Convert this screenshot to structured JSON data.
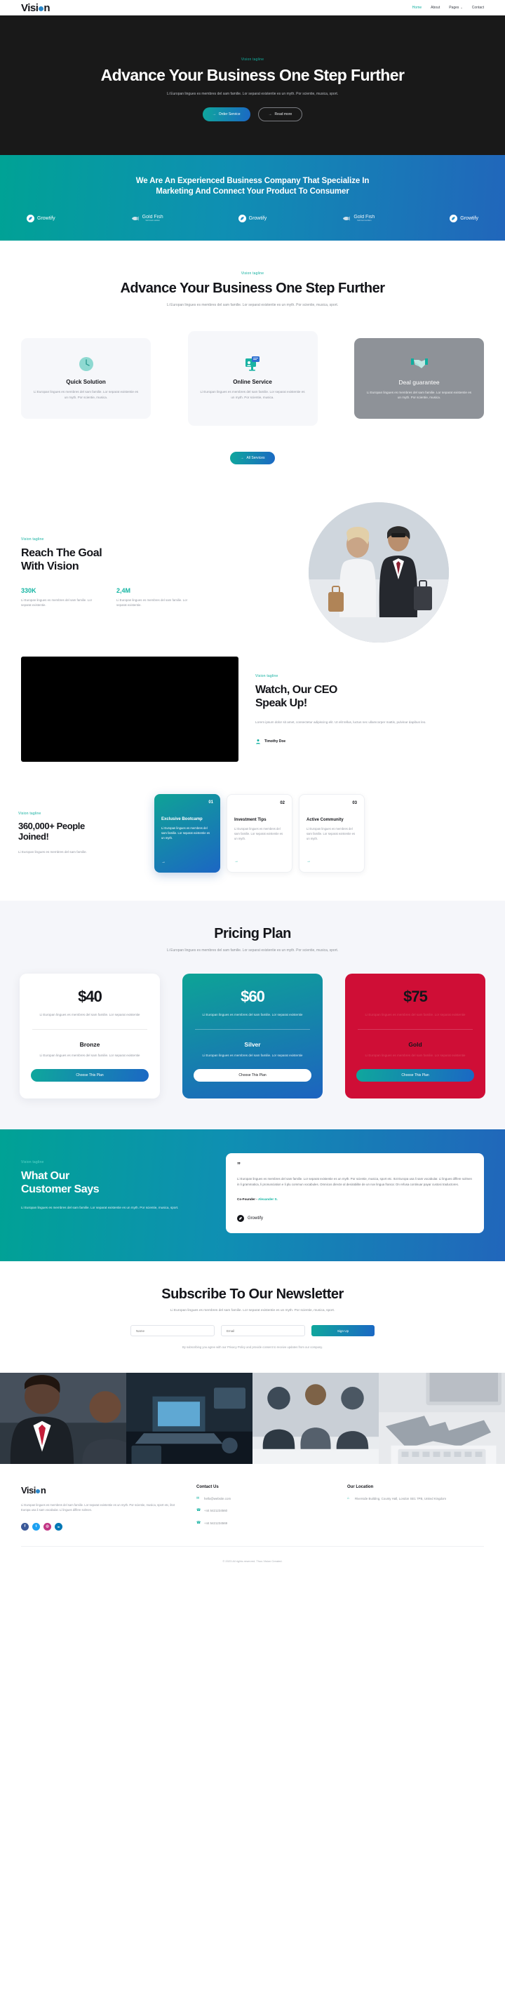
{
  "brand": {
    "name_part1": "Visi",
    "name_part2": "n",
    "dot": "o"
  },
  "nav": {
    "items": [
      {
        "label": "Home",
        "active": true
      },
      {
        "label": "About",
        "active": false
      },
      {
        "label": "Pages",
        "active": false,
        "caret": "⌄"
      },
      {
        "label": "Contact",
        "active": false
      }
    ]
  },
  "hero": {
    "tagline": "Vision tagline",
    "title": "Advance Your Business One Step Further",
    "subtitle": "Li Europan lingues es membres del sam familie. Lor separat existentie es un myth. Por scientie, musica, sport.",
    "primary_btn": "Order Service",
    "secondary_btn": "Read more",
    "arrow": "→"
  },
  "banner": {
    "heading_line1": "We Are An Experienced Business Company That Specialize In",
    "heading_line2": "Marketing And Connect Your Product To Consumer",
    "brands": [
      {
        "name": "Growtify",
        "type": "growtify"
      },
      {
        "name": "Gold Fish",
        "type": "goldfish",
        "sub": "Soft food nutrition"
      },
      {
        "name": "Growtify",
        "type": "growtify"
      },
      {
        "name": "Gold Fish",
        "type": "goldfish",
        "sub": "Soft food nutrition"
      },
      {
        "name": "Growtify",
        "type": "growtify"
      }
    ]
  },
  "services": {
    "tagline": "Vision tagline",
    "title": "Advance Your Business One Step Further",
    "subtitle": "Li Europan lingues es membres del sam familie. Lor separat existentie es un myth. Por scientie, musica, sport.",
    "cards": [
      {
        "title": "Quick Solution",
        "text": "Li Europan lingues es membres del sam familie. Lor separat existentie es un myth. Por scientie, musica.",
        "icon": "clock-icon"
      },
      {
        "title": "Online Service",
        "text": "Li Europan lingues es membres del sam familie. Lor separat existentie es un myth. Por scientie, musica.",
        "icon": "online-service-icon"
      },
      {
        "title": "Deal guarantee",
        "text": "Li Europan lingues es membres del sam familie. Lor separat existentie es un myth. Por scientie, musica.",
        "icon": "handshake-icon"
      }
    ],
    "button": "All Services"
  },
  "goal": {
    "tagline": "Vision tagline",
    "title_line1": "Reach The Goal",
    "title_line2": "With Vision",
    "stats": [
      {
        "num": "330K",
        "text": "Li Europan lingues es membres del sam familie. Lor separat existentie."
      },
      {
        "num": "2,4M",
        "text": "Li Europan lingues es membres del sam familie. Lor separat existentie."
      }
    ]
  },
  "ceo": {
    "tagline": "Vision tagline",
    "title_line1": "Watch, Our CEO",
    "title_line2": "Speak Up!",
    "body": "Lorem ipsum dolor sit amet, consectetur adipiscing elit. Ut elit tellus, luctus nec ullamcorper mattis, pulvinar dapibus leo.",
    "author": "Timothy Doe"
  },
  "joined": {
    "tagline": "Vision tagline",
    "title_line1": "360,000+ People",
    "title_line2": "Joined!",
    "subtitle": "Li Europan lingues es membres del sam familie.",
    "cards": [
      {
        "no": "01",
        "title": "Exclusive Bootcamp",
        "text": "Li Europan lingues es membres del sam familie. Lor separat existentie es un myth.",
        "arrow": "→"
      },
      {
        "no": "02",
        "title": "Investment Tips",
        "text": "Li Europan lingues es membres del sam familie. Lor separat existentie es un myth.",
        "arrow": "→"
      },
      {
        "no": "03",
        "title": "Active Community",
        "text": "Li Europan lingues es membres del sam familie. Lor separat existentie es un myth.",
        "arrow": "→"
      }
    ]
  },
  "pricing": {
    "title": "Pricing Plan",
    "subtitle": "Li Europan lingues es membres del sam familie. Lor separat existentie es un myth. Por scientie, musica, sport.",
    "plans": [
      {
        "price": "$40",
        "desc": "Li Europan lingues es membres del sam familie. Lor separat existentie",
        "tier": "Bronze",
        "tier_desc": "Li Europan lingues es membres del sam familie. Lor separat existentie",
        "button": "Choose This Plan"
      },
      {
        "price": "$60",
        "desc": "Li Europan lingues es membres del sam familie. Lor separat existentie",
        "tier": "Silver",
        "tier_desc": "Li Europan lingues es membres del sam familie. Lor separat existentie",
        "button": "Choose This Plan"
      },
      {
        "price": "$75",
        "desc": "Li Europan lingues es membres del sam familie. Lor separat existentie",
        "tier": "Gold",
        "tier_desc": "Li Europan lingues es membres del sam familie. Lor separat existentie",
        "button": "Choose This Plan"
      }
    ]
  },
  "testimonial": {
    "tagline": "Vision tagline",
    "title_line1": "What Our",
    "title_line2": "Customer Says",
    "subtitle": "Li Europan lingues es membres del sam familie. Lor separat existentie es un myth. Por scientie, musica, sport.",
    "quote_mark": "”",
    "body": "Li Europan lingues es membres del sam familie. Lor separat existentie es un myth. Por scientie, musica, sport etc. Itot Europa usa li sam vocabular. Li lingues differe solmen in li grammatica, li pronunciation e li plu commun vocabules. Omnicos directe al desirabilite de un nov lingua franca: On refusa continuar payar custosi traductores.",
    "role": "Co-Founder - ",
    "person": "Alexander S.",
    "brand": "Growtify"
  },
  "newsletter": {
    "title": "Subscribe To Our Newsletter",
    "subtitle": "Li Europan lingues es membres del sam familie. Lor separat existentie es un myth. Por scientie, musica, sport.",
    "name_placeholder": "Name",
    "email_placeholder": "Email",
    "button": "Sign Up",
    "legal": "By subscribing you agree with our Privacy Policy and provide consent to receive updates from our company."
  },
  "footer": {
    "about": "Li Europan lingues es membres del sam familie. Lor separat existentie es un myth. Por scientie, musica, sport etc, litot Europa usa li sam vocabular. Li lingues differe solmen.",
    "socials": [
      {
        "name": "facebook-icon",
        "glyph": "f",
        "color": "#3b5998"
      },
      {
        "name": "twitter-icon",
        "glyph": "t",
        "color": "#1da1f2"
      },
      {
        "name": "instagram-icon",
        "glyph": "◎",
        "color": "#c13584"
      },
      {
        "name": "linkedin-icon",
        "glyph": "in",
        "color": "#0077b5"
      }
    ],
    "contact": {
      "heading": "Contact Us",
      "rows": [
        {
          "icon": "✉",
          "icon_name": "mail-icon",
          "text": "hello@website.com"
        },
        {
          "icon": "☎",
          "icon_name": "phone-icon",
          "text": "+44 5421234560"
        },
        {
          "icon": "☎",
          "icon_name": "phone-icon-2",
          "text": "+44 5421234569"
        }
      ]
    },
    "location": {
      "heading": "Our Location",
      "rows": [
        {
          "icon": "⌂",
          "icon_name": "building-icon",
          "text": "Riverside Building, County Hall, London SE1 7PB, United Kingdom"
        }
      ]
    },
    "copyright": "© 2023 All rights reserved. Thus Vision Created."
  }
}
